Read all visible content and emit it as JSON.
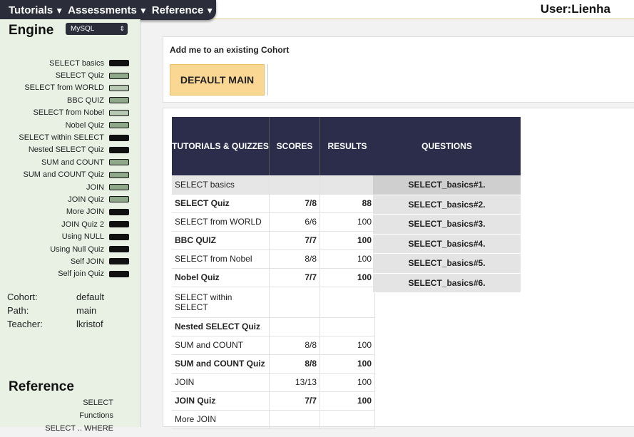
{
  "nav": {
    "items": [
      {
        "label": "Tutorials",
        "arrow": "▼"
      },
      {
        "label": "Assessments",
        "arrow": "▼"
      },
      {
        "label": "Reference",
        "arrow": "▼"
      }
    ],
    "user": "User:Lienha"
  },
  "sidebar": {
    "engine_label": "Engine",
    "engine_value": "MySQL",
    "tutorials": [
      {
        "label": "SELECT basics",
        "status": "complete"
      },
      {
        "label": "SELECT Quiz",
        "status": "partial"
      },
      {
        "label": "SELECT from WORLD",
        "status": "light"
      },
      {
        "label": "BBC QUIZ",
        "status": "partial"
      },
      {
        "label": "SELECT from Nobel",
        "status": "light"
      },
      {
        "label": "Nobel Quiz",
        "status": "partial"
      },
      {
        "label": "SELECT within SELECT",
        "status": "complete"
      },
      {
        "label": "Nested SELECT Quiz",
        "status": "complete"
      },
      {
        "label": "SUM and COUNT",
        "status": "partial"
      },
      {
        "label": "SUM and COUNT Quiz",
        "status": "partial"
      },
      {
        "label": "JOIN",
        "status": "partial"
      },
      {
        "label": "JOIN Quiz",
        "status": "partial"
      },
      {
        "label": "More JOIN",
        "status": "complete"
      },
      {
        "label": "JOIN Quiz 2",
        "status": "complete"
      },
      {
        "label": "Using NULL",
        "status": "complete"
      },
      {
        "label": "Using Null Quiz",
        "status": "complete"
      },
      {
        "label": "Self JOIN",
        "status": "complete"
      },
      {
        "label": "Self join Quiz",
        "status": "complete"
      }
    ],
    "info": [
      {
        "key": "Cohort:",
        "value": "default"
      },
      {
        "key": "Path:",
        "value": "main"
      },
      {
        "key": "Teacher:",
        "value": "lkristof"
      }
    ],
    "reference_label": "Reference",
    "reference_items": [
      "SELECT",
      "Functions",
      "SELECT .. WHERE"
    ]
  },
  "cohort": {
    "title": "Add me to an existing Cohort",
    "button": "DEFAULT MAIN"
  },
  "results": {
    "headers": [
      "TUTORIALS & QUIZZES",
      "SCORES",
      "RESULTS"
    ],
    "rows": [
      {
        "name": "SELECT basics",
        "score": "",
        "result": "",
        "bold": false,
        "grey": true
      },
      {
        "name": "SELECT Quiz",
        "score": "7/8",
        "result": "88",
        "bold": true
      },
      {
        "name": "SELECT from WORLD",
        "score": "6/6",
        "result": "100",
        "bold": false
      },
      {
        "name": "BBC QUIZ",
        "score": "7/7",
        "result": "100",
        "bold": true
      },
      {
        "name": "SELECT from Nobel",
        "score": "8/8",
        "result": "100",
        "bold": false
      },
      {
        "name": "Nobel Quiz",
        "score": "7/7",
        "result": "100",
        "bold": true
      },
      {
        "name": "SELECT within SELECT",
        "score": "",
        "result": "",
        "bold": false,
        "tall": true
      },
      {
        "name": "Nested SELECT Quiz",
        "score": "",
        "result": "",
        "bold": true
      },
      {
        "name": "SUM and COUNT",
        "score": "8/8",
        "result": "100",
        "bold": false
      },
      {
        "name": "SUM and COUNT Quiz",
        "score": "8/8",
        "result": "100",
        "bold": true
      },
      {
        "name": "JOIN",
        "score": "13/13",
        "result": "100",
        "bold": false
      },
      {
        "name": "JOIN Quiz",
        "score": "7/7",
        "result": "100",
        "bold": true
      },
      {
        "name": "More JOIN",
        "score": "",
        "result": "",
        "bold": false
      }
    ],
    "questions_header": "QUESTIONS",
    "questions": [
      "SELECT_basics#1.",
      "SELECT_basics#2.",
      "SELECT_basics#3.",
      "SELECT_basics#4.",
      "SELECT_basics#5.",
      "SELECT_basics#6."
    ]
  }
}
